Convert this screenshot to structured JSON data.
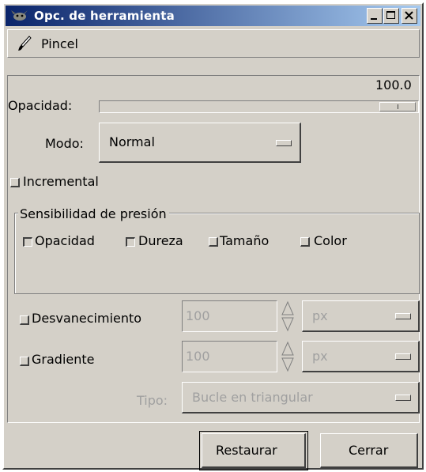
{
  "window": {
    "title": "Opc. de herramienta",
    "controls": [
      "minimize-icon",
      "maximize-icon",
      "close-icon"
    ]
  },
  "tool": {
    "icon": "brush-icon",
    "name": "Pincel"
  },
  "opacity": {
    "label": "Opacidad:",
    "value": "100.0",
    "percent": 100
  },
  "mode": {
    "label": "Modo:",
    "value": "Normal"
  },
  "incremental": {
    "label": "Incremental",
    "checked": false
  },
  "pressure": {
    "title": "Sensibilidad de presión",
    "options": [
      {
        "label": "Opacidad",
        "checked": true
      },
      {
        "label": "Dureza",
        "checked": true
      },
      {
        "label": "Tamaño",
        "checked": false
      },
      {
        "label": "Color",
        "checked": false
      }
    ]
  },
  "fade": {
    "label": "Desvanecimiento",
    "value": "100",
    "unit": "px",
    "checked": false
  },
  "gradient": {
    "label": "Gradiente",
    "value": "100",
    "unit": "px",
    "checked": false
  },
  "type": {
    "label": "Tipo:",
    "value": "Bucle en triangular"
  },
  "buttons": {
    "reset": "Restaurar",
    "close": "Cerrar"
  }
}
